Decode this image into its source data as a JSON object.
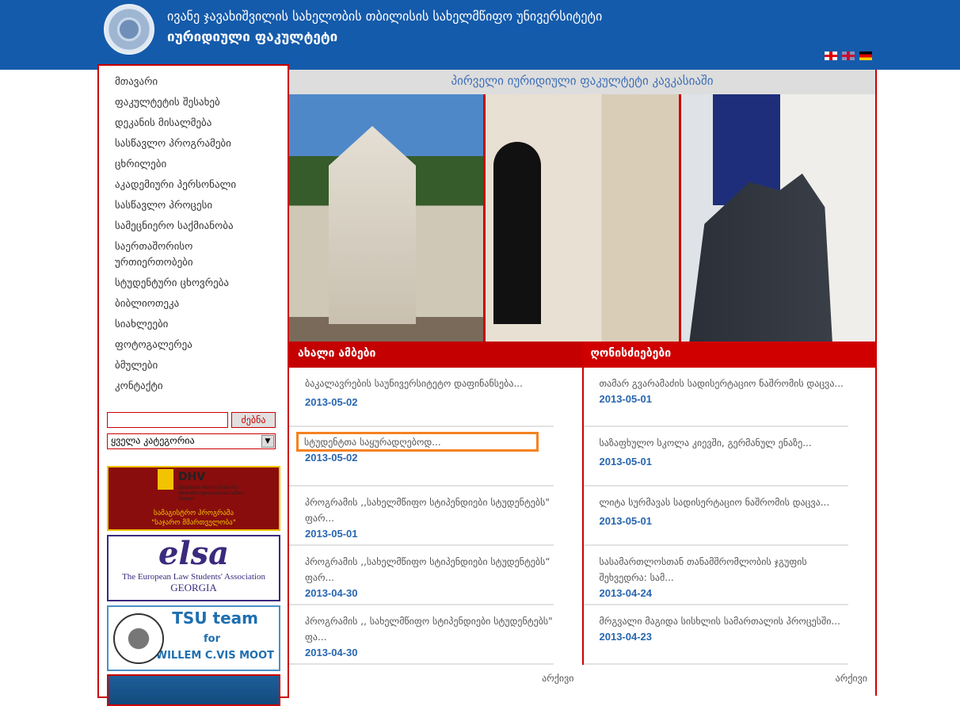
{
  "header": {
    "university": "ივანე ჯავახიშვილის სახელობის თბილისის სახელმწიფო უნივერსიტეტი",
    "faculty": "იურიდიული ფაკულტეტი",
    "languages": [
      "ka",
      "en",
      "de"
    ]
  },
  "sidebar": {
    "nav": [
      "მთავარი",
      "ფაკულტეტის შესახებ",
      "დეკანის მისალმება",
      "სასწავლო პროგრამები",
      "ცხრილები",
      "აკადემიური პერსონალი",
      "სასწავლო პროცესი",
      "სამეცნიერო საქმიანობა",
      "საერთაშორისო ურთიერთობები",
      "სტუდენტური ცხოვრება",
      "ბიბლიოთეკა",
      "სიახლეები",
      "ფოტოგალერეა",
      "ბმულები",
      "კონტაქტი"
    ],
    "search": {
      "value": "",
      "button": "ძებნა",
      "category": "ყველა კატეგორია"
    },
    "banners": {
      "dhv": {
        "title": "DHV",
        "subtitle": "Deutsche Hochschule für Verwaltungswissenschaften Speyer",
        "program": "სამაგისტრო პროგრამა",
        "program_name": "\"საჯარო მმართველობა\""
      },
      "elsa": {
        "logo": "elsa",
        "name": "The European Law Students' Association",
        "country": "GEORGIA"
      },
      "tsu": {
        "line1": "TSU team",
        "line2": "for",
        "line3": "WILLEM C.VIS MOOT"
      }
    }
  },
  "main": {
    "tagline": "პირველი იურიდიული ფაკულტეტი კავკასიაში",
    "news": {
      "title": "ახალი ამბები",
      "archive": "არქივი",
      "items": [
        {
          "title": "ბაკალავრების საუნივერსიტეტო დაფინანსება...",
          "date": "2013-05-02"
        },
        {
          "title": "სტუდენტთა საყურადღებოდ...",
          "date": "2013-05-02"
        },
        {
          "title": "პროგრამის ,,სახელმწიფო სტიპენდიები სტუდენტებს\" ფარ...",
          "date": "2013-05-01"
        },
        {
          "title": "პროგრამის ,,სახელმწიფო სტიპენდიები სტუდენტებს“ ფარ...",
          "date": "2013-04-30"
        },
        {
          "title": "პროგრამის ,, სახელმწიფო სტიპენდიები სტუდენტებს\" ფა...",
          "date": "2013-04-30"
        }
      ]
    },
    "events": {
      "title": "ღონისძიებები",
      "archive": "არქივი",
      "items": [
        {
          "title": "თამარ გვარამაძის სადისერტაციო ნაშრომის დაცვა...",
          "date": "2013-05-01"
        },
        {
          "title": "საზაფხულო სკოლა კიევში, გერმანულ ენაზე...",
          "date": "2013-05-01"
        },
        {
          "title": "ლიტა სურმავას სადისერტაციო ნაშრომის დაცვა...",
          "date": "2013-05-01"
        },
        {
          "title": "სასამართლოსთან თანამშრომლობის ჯგუფის შეხვედრა: სამ...",
          "date": "2013-04-24"
        },
        {
          "title": "მრგვალი მაგიდა სისხლის სამართალის პროცესში...",
          "date": "2013-04-23"
        }
      ]
    }
  },
  "colors": {
    "header": "#155bab",
    "accent": "#c40000",
    "date": "#2766b0",
    "highlight": "#f58220"
  }
}
